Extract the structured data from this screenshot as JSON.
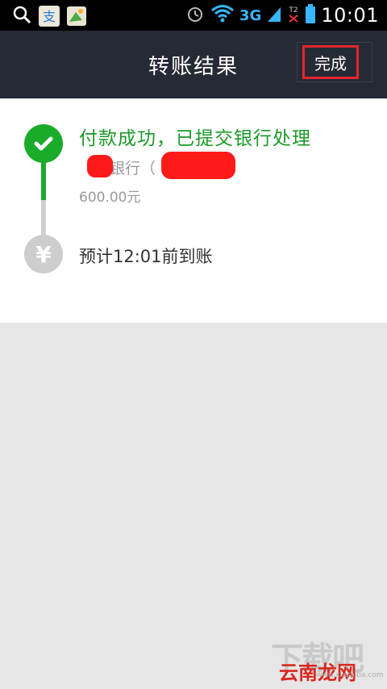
{
  "status_bar": {
    "network": "3G",
    "time": "10:01"
  },
  "title_bar": {
    "title": "转账结果",
    "done_label": "完成"
  },
  "result": {
    "status": "付款成功，已提交银行处理",
    "bank": "银行（",
    "bank_close": "）",
    "amount": "600.00元",
    "eta": "预计12:01前到账"
  },
  "watermark": {
    "big": "下载吧",
    "red": "云南龙网",
    "small": "www.xiazaiba.com"
  },
  "colors": {
    "success_green": "#1aab2b",
    "title_bg": "#262a35",
    "highlight_red": "#e2262e"
  }
}
